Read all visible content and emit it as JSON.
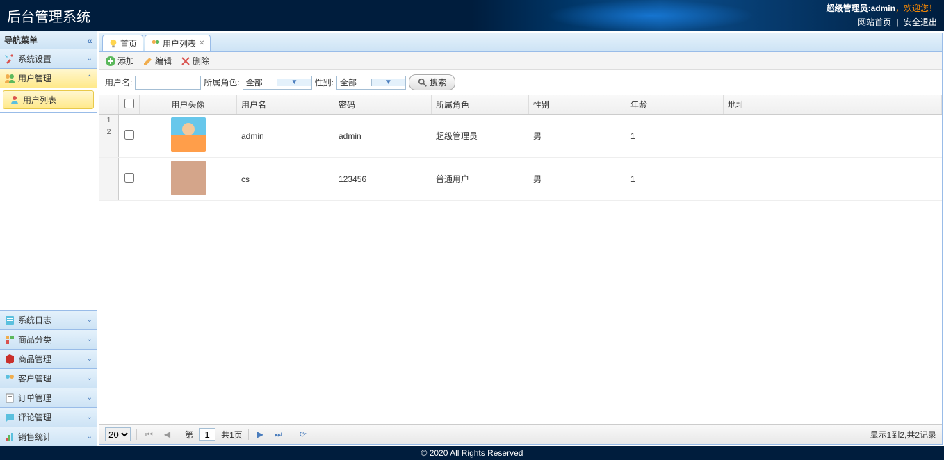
{
  "header": {
    "title": "后台管理系统",
    "admin_label": "超级管理员:admin",
    "welcome": "，欢迎您！",
    "home_link": "网站首页",
    "logout_link": "安全退出"
  },
  "sidebar": {
    "title": "导航菜单",
    "items": [
      {
        "label": "系统设置",
        "expanded": false
      },
      {
        "label": "用户管理",
        "expanded": true,
        "children": [
          {
            "label": "用户列表"
          }
        ]
      },
      {
        "label": "系统日志",
        "expanded": false
      },
      {
        "label": "商品分类",
        "expanded": false
      },
      {
        "label": "商品管理",
        "expanded": false
      },
      {
        "label": "客户管理",
        "expanded": false
      },
      {
        "label": "订单管理",
        "expanded": false
      },
      {
        "label": "评论管理",
        "expanded": false
      },
      {
        "label": "销售统计",
        "expanded": false
      }
    ]
  },
  "tabs": [
    {
      "label": "首页",
      "closable": false
    },
    {
      "label": "用户列表",
      "closable": true,
      "active": true
    }
  ],
  "toolbar": {
    "add": "添加",
    "edit": "编辑",
    "delete": "删除"
  },
  "search": {
    "username_label": "用户名:",
    "role_label": "所属角色:",
    "role_value": "全部",
    "gender_label": "性别:",
    "gender_value": "全部",
    "button": "搜索"
  },
  "grid": {
    "columns": {
      "avatar": "用户头像",
      "username": "用户名",
      "password": "密码",
      "role": "所属角色",
      "gender": "性别",
      "age": "年龄",
      "address": "地址"
    },
    "rows": [
      {
        "rownum": "1",
        "rownum2": "2",
        "username": "admin",
        "password": "admin",
        "role": "超级管理员",
        "gender": "男",
        "age": "1",
        "address": ""
      },
      {
        "username": "cs",
        "password": "123456",
        "role": "普通用户",
        "gender": "男",
        "age": "1",
        "address": ""
      }
    ],
    "footer": {
      "page_size": "20",
      "page_label_pre": "第",
      "page_current": "1",
      "page_label_post": "共1页",
      "info": "显示1到2,共2记录"
    }
  },
  "footer": {
    "copyright": "© 2020 All Rights Reserved"
  }
}
